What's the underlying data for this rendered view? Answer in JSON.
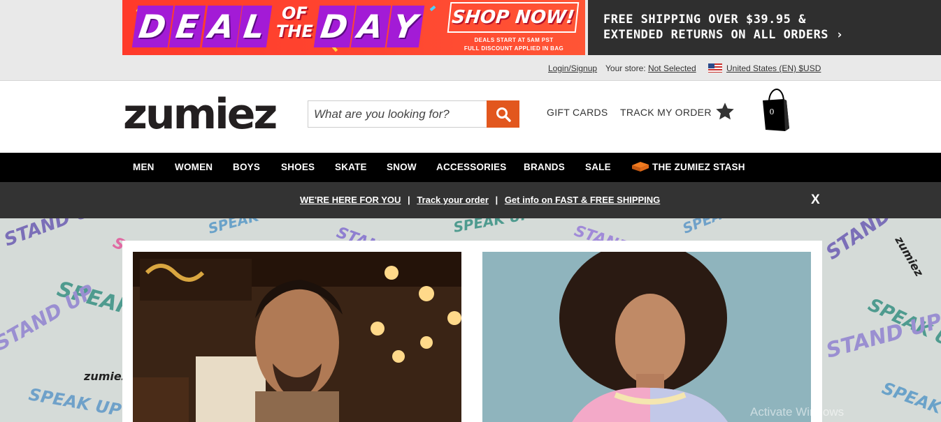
{
  "promo": {
    "deal_letters": [
      "D",
      "E",
      "A",
      "L"
    ],
    "of_the": [
      "OF",
      "THE"
    ],
    "day_letters": [
      "D",
      "A",
      "Y"
    ],
    "shop_now": "SHOP NOW!",
    "deal_sub_1": "DEALS START AT 5AM PST",
    "deal_sub_2": "FULL DISCOUNT APPLIED IN BAG",
    "shipping_line_1": "FREE SHIPPING OVER $39.95 &",
    "shipping_line_2": "EXTENDED RETURNS ON ALL ORDERS",
    "shipping_arrow": "›"
  },
  "utility": {
    "login": "Login/Signup",
    "store_label": "Your store:",
    "store_value": "Not Selected",
    "region": "United States (EN) $USD"
  },
  "header": {
    "logo": "zumiez",
    "search_placeholder": "What are you looking for?",
    "gift_cards": "GIFT CARDS",
    "track_order": "TRACK MY ORDER",
    "cart_count": "0"
  },
  "nav": {
    "items": [
      "MEN",
      "WOMEN",
      "BOYS",
      "SHOES",
      "SKATE",
      "SNOW",
      "ACCESSORIES",
      "BRANDS",
      "SALE",
      "THE ZUMIEZ STASH"
    ]
  },
  "announce": {
    "link_1": "WE'RE HERE FOR YOU",
    "link_2": "Track your order",
    "link_3": "Get info on FAST & FREE SHIPPING",
    "separator": "|",
    "close": "X"
  },
  "hero": {
    "bg_stickers": [
      "STAND UP",
      "SPEAK UP",
      "zumiez"
    ]
  },
  "os": {
    "watermark": "Activate Windows"
  },
  "colors": {
    "accent_orange": "#e2571e",
    "deal_red": "#ff3a2a",
    "deal_purple": "#a31bd6",
    "nav_black": "#000000",
    "announce_gray": "#333333"
  }
}
